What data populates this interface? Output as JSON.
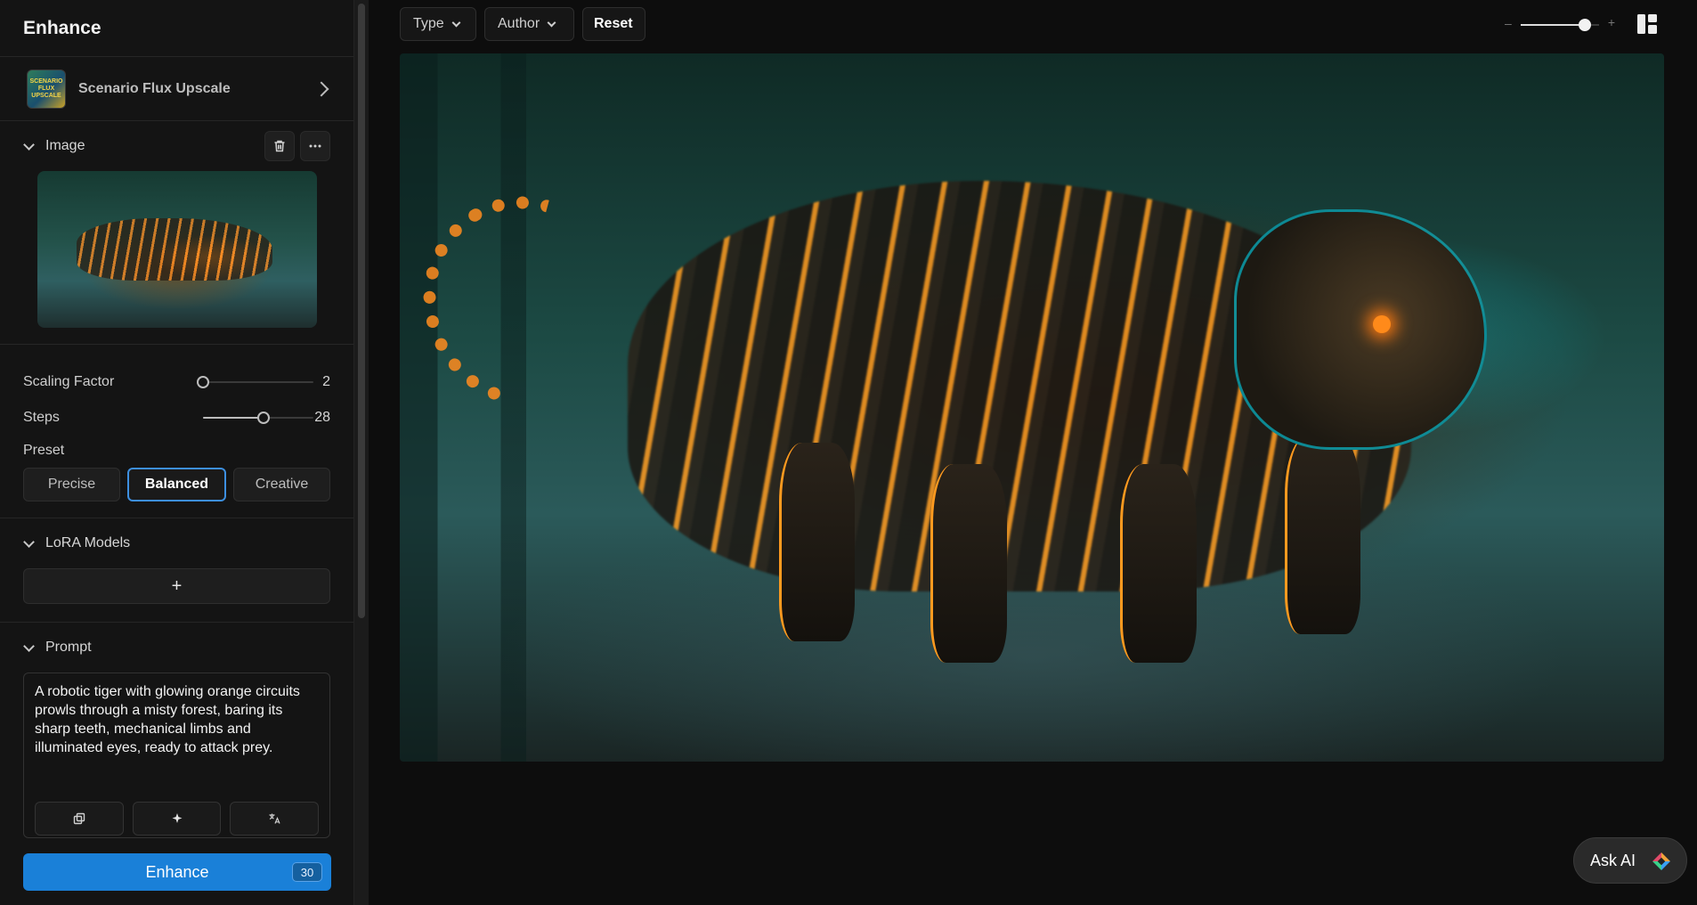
{
  "sidebar": {
    "title": "Enhance",
    "model": {
      "name": "Scenario Flux Upscale",
      "thumb_text": "SCENARIO FLUX UPSCALE"
    },
    "image_section": {
      "label": "Image"
    },
    "params": {
      "scaling_factor": {
        "label": "Scaling Factor",
        "value": "2",
        "fraction": 0.0
      },
      "steps": {
        "label": "Steps",
        "value": "28",
        "fraction": 0.55
      }
    },
    "preset": {
      "label": "Preset",
      "options": [
        "Precise",
        "Balanced",
        "Creative"
      ],
      "selected": "Balanced"
    },
    "lora": {
      "label": "LoRA Models",
      "add_label": "+"
    },
    "prompt": {
      "label": "Prompt",
      "text": "A robotic tiger with glowing orange circuits prowls through a misty forest, baring its sharp teeth, mechanical limbs and illuminated eyes, ready to attack prey."
    },
    "enhance": {
      "label": "Enhance",
      "credits": "30"
    }
  },
  "toolbar": {
    "type_label": "Type",
    "author_label": "Author",
    "reset_label": "Reset",
    "zoom": {
      "minus": "–",
      "plus": "+",
      "fraction": 0.82
    }
  },
  "ask_ai": {
    "label": "Ask AI"
  },
  "colors": {
    "accent": "#1a80d8",
    "selected_border": "#3d8fe0",
    "background": "#0d0d0d",
    "panel": "#141414"
  }
}
